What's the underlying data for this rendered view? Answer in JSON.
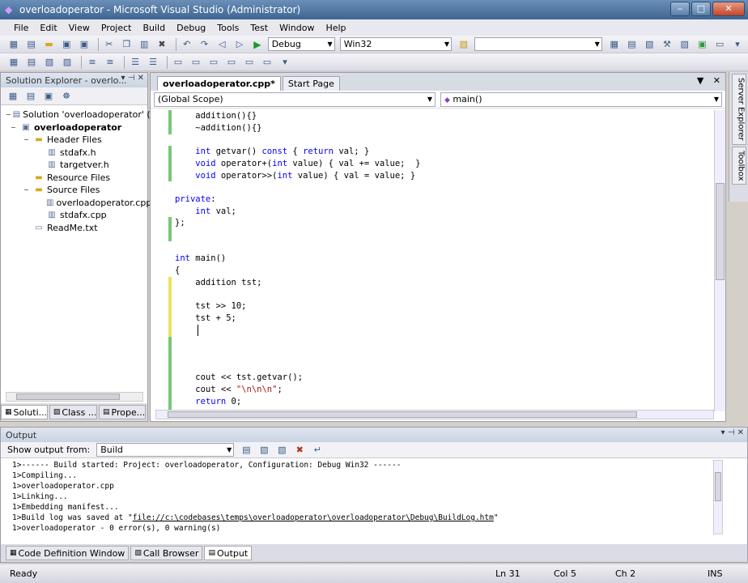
{
  "window": {
    "title": "overloadoperator - Microsoft Visual Studio (Administrator)",
    "min_glyph": "‒",
    "max_glyph": "□",
    "close_glyph": "✕"
  },
  "menu": {
    "items": [
      "File",
      "Edit",
      "View",
      "Project",
      "Build",
      "Debug",
      "Tools",
      "Test",
      "Window",
      "Help"
    ]
  },
  "toolbar": {
    "config": "Debug",
    "platform": "Win32"
  },
  "solution_explorer": {
    "title": "Solution Explorer - overlo...",
    "tree": [
      {
        "label": "Solution 'overloadoperator' (1 pr",
        "icon": "solution-icon",
        "level": 0,
        "bold": false
      },
      {
        "label": "overloadoperator",
        "icon": "project-icon",
        "level": 0,
        "bold": true
      },
      {
        "label": "Header Files",
        "icon": "folder-icon",
        "level": 1,
        "bold": false
      },
      {
        "label": "stdafx.h",
        "icon": "header-file-icon",
        "level": 2,
        "bold": false
      },
      {
        "label": "targetver.h",
        "icon": "header-file-icon",
        "level": 2,
        "bold": false
      },
      {
        "label": "Resource Files",
        "icon": "folder-icon",
        "level": 1,
        "bold": false
      },
      {
        "label": "Source Files",
        "icon": "folder-icon",
        "level": 1,
        "bold": false
      },
      {
        "label": "overloadoperator.cpp",
        "icon": "cpp-file-icon",
        "level": 2,
        "bold": false
      },
      {
        "label": "stdafx.cpp",
        "icon": "cpp-file-icon",
        "level": 2,
        "bold": false
      },
      {
        "label": "ReadMe.txt",
        "icon": "text-file-icon",
        "level": 1,
        "bold": false
      }
    ],
    "tabs": [
      "Soluti...",
      "Class ...",
      "Prope..."
    ]
  },
  "editor": {
    "tabs": [
      "overloadoperator.cpp*",
      "Start Page"
    ],
    "scope": "(Global Scope)",
    "member": "main()",
    "code": [
      "    addition(){}",
      "    ~addition(){}",
      "",
      "    int getvar() const { return val; }",
      "    void operator+(int value) { val += value;  }",
      "    void operator>>(int value) { val = value; }",
      "",
      "private:",
      "    int val;",
      "};",
      "",
      "",
      "int main()",
      "{",
      "    addition tst;",
      "",
      "    tst >> 10;",
      "    tst + 5;",
      "",
      "",
      "",
      "",
      "    cout << tst.getvar();",
      "    cout << \"\\n\\n\\n\";",
      "    return 0;"
    ]
  },
  "side_tabs": [
    "Server Explorer",
    "Toolbox"
  ],
  "output": {
    "title": "Output",
    "show_from_label": "Show output from:",
    "source": "Build",
    "lines": [
      "1>------ Build started: Project: overloadoperator, Configuration: Debug Win32 ------",
      "1>Compiling...",
      "1>overloadoperator.cpp",
      "1>Linking...",
      "1>Embedding manifest...",
      "1>Build log was saved at \"file://c:\\codebases\\temps\\overloadoperator\\overloadoperator\\Debug\\BuildLog.htm\"",
      "1>overloadoperator - 0 error(s), 0 warning(s)"
    ],
    "tabs": [
      "Code Definition Window",
      "Call Browser",
      "Output"
    ]
  },
  "status": {
    "text": "Ready",
    "line": "Ln 31",
    "col": "Col 5",
    "ch": "Ch 2",
    "mode": "INS"
  }
}
